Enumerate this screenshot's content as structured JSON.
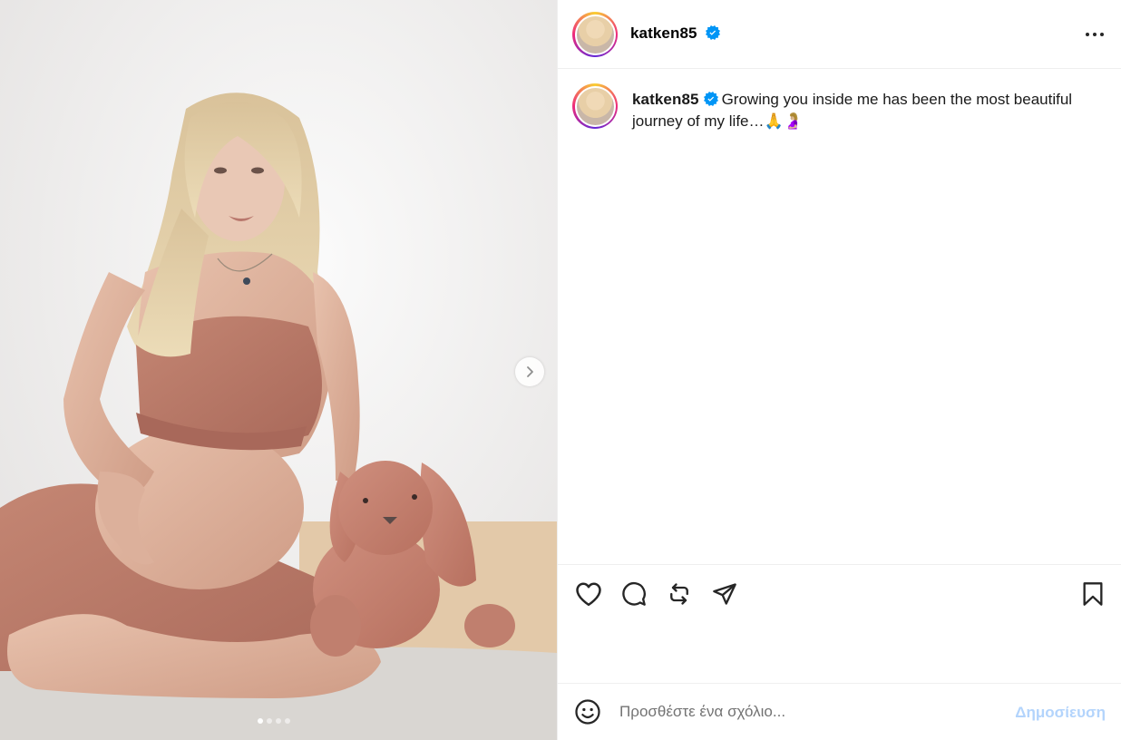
{
  "media": {
    "alt": "photo",
    "next_icon": "chevron-right-icon",
    "slide_count": 4,
    "active_slide": 1
  },
  "header": {
    "username": "katken85",
    "verified_icon": "verified-badge-icon",
    "more_icon": "more-horizontal-icon"
  },
  "caption": {
    "username": "katken85",
    "text": "Growing you inside me has been the most beautiful journey of my life…🙏🤰🏼"
  },
  "actions": {
    "like_icon": "heart-icon",
    "comment_icon": "comment-icon",
    "repost_icon": "repost-icon",
    "share_icon": "share-icon",
    "save_icon": "bookmark-icon"
  },
  "comment_bar": {
    "emoji_icon": "emoji-icon",
    "placeholder": "Προσθέστε ένα σχόλιο...",
    "value": "",
    "post_label": "Δημοσίευση"
  },
  "colors": {
    "accent_disabled": "#b3d4fc",
    "verified": "#0095f6",
    "divider": "#efefef"
  }
}
